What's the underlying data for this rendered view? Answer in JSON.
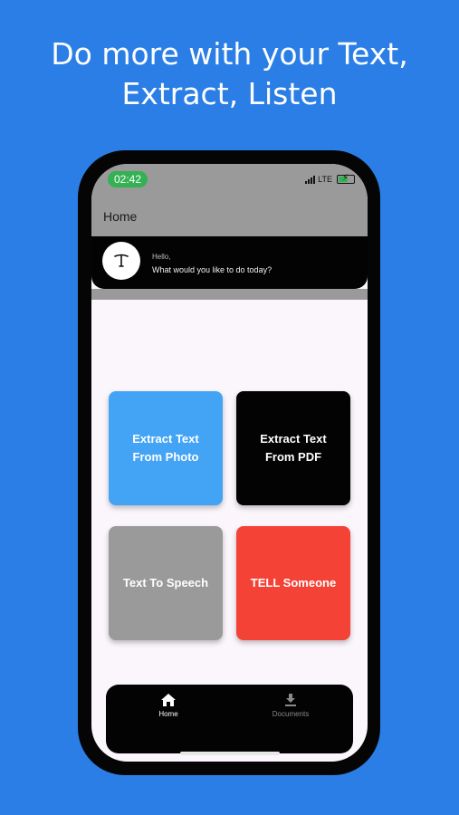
{
  "headline": {
    "line1": "Do more with your Text,",
    "line2": "Extract, Listen"
  },
  "status_bar": {
    "time": "02:42",
    "network": "LTE"
  },
  "app_bar": {
    "title": "Home"
  },
  "greeting": {
    "hello": "Hello,",
    "question": "What would you like to do today?"
  },
  "tiles": [
    {
      "label": "Extract Text From Photo",
      "color": "#43a4f5"
    },
    {
      "label": "Extract Text From PDF",
      "color": "#030303"
    },
    {
      "label": "Text To Speech",
      "color": "#9a9a9a"
    },
    {
      "label": "TELL Someone",
      "color": "#f44336"
    }
  ],
  "bottom_nav": [
    {
      "label": "Home",
      "icon": "home-icon",
      "selected": true
    },
    {
      "label": "Documents",
      "icon": "download-icon",
      "selected": false
    }
  ],
  "colors": {
    "background": "#2a7ee5",
    "status_pill": "#33b153",
    "app_bar": "#9a9a9a"
  }
}
